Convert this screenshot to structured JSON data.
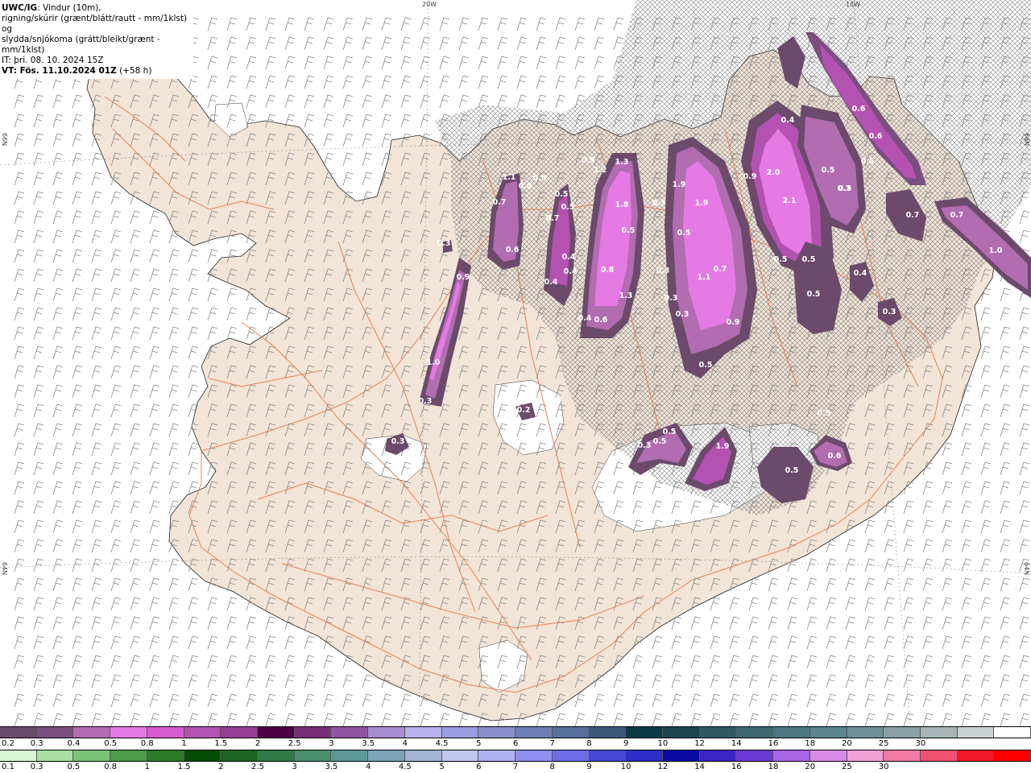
{
  "header": {
    "source": "UWC/IG",
    "description_line1": ": Vindur (10m),",
    "description_line2": "rigning/skúrir (grænt/blátt/rautt - mm/1klst) og",
    "description_line3": "slydda/snjókoma (grátt/bleikt/grænt - mm/1klst)",
    "issued": "IT: þri. 08. 10. 2024 15Z",
    "valid": "VT: Fös. 11.10.2024 01Z",
    "lead": " (+58 h)"
  },
  "grid_labels": {
    "lon_20w": "20W",
    "lon_15w": "15W",
    "lat_66n_left": "66N",
    "lat_66n_right": "66N",
    "lat_64n_left": "64N",
    "lat_64n_right": "64N"
  },
  "precip_values": [
    "0.9",
    "1.2",
    "1.3",
    "1.9",
    "2.0",
    "2.1",
    "0.9",
    "0.8",
    "1.1",
    "0.7",
    "0.5",
    "0.5",
    "0.6",
    "1.8",
    "0.3",
    "1.9",
    "0.5",
    "0.4",
    "0.5",
    "0.7",
    "0.8",
    "0.4",
    "0.4",
    "0.7",
    "0.9",
    "1.0",
    "0.3",
    "0.5",
    "0.7",
    "1.1",
    "0.3",
    "0.6",
    "0.4",
    "0.4",
    "0.6",
    "1.3",
    "0.3",
    "0.3",
    "0.9",
    "0.5",
    "0.5",
    "0.5",
    "0.4",
    "0.3",
    "0.3",
    "0.5",
    "0.6",
    "0.5",
    "0.6",
    "0.5",
    "0.7",
    "0.7",
    "1.0",
    "0.2",
    "0.3",
    "0.3",
    "0.5",
    "0.5",
    "1.9",
    "0.5",
    "0.6",
    "0.5",
    "0.3"
  ],
  "legend_snow": {
    "colors": [
      "#6b4a6b",
      "#7a4e7e",
      "#b26cb0",
      "#e57ae5",
      "#d65bd0",
      "#b452b2",
      "#9a3d96",
      "#4d0046",
      "#7c2e7a",
      "#8e56a1",
      "#a98dd1",
      "#b8b2ec",
      "#9c9ce2",
      "#8990cc",
      "#6f7fb5",
      "#566e9b",
      "#3d5a7a",
      "#0d3b45",
      "#1b4651",
      "#2d5a63",
      "#3c6870",
      "#4c7680",
      "#5c848c",
      "#718f97",
      "#8ba0a5",
      "#a6b4b6",
      "#c9d2d1",
      "#ffffff"
    ],
    "labels": [
      "0.2",
      "0.3",
      "0.4",
      "0.5",
      "0.8",
      "1",
      "1.5",
      "2",
      "2.5",
      "3",
      "3.5",
      "4",
      "4.5",
      "5",
      "6",
      "7",
      "8",
      "9",
      "10",
      "12",
      "14",
      "16",
      "18",
      "20",
      "25",
      "30"
    ]
  },
  "legend_rain": {
    "colors": [
      "#d8f5d5",
      "#a8e0a4",
      "#7cc378",
      "#4c9b48",
      "#2b7a28",
      "#064d05",
      "#1e6620",
      "#2f7a46",
      "#4a8e6d",
      "#5e9896",
      "#7ea3b8",
      "#a2b5d5",
      "#c1c6ee",
      "#b0b0f4",
      "#8f8ff0",
      "#6d6de8",
      "#4747d8",
      "#2e2eca",
      "#0a0aa3",
      "#3a24c2",
      "#6a3ad4",
      "#a865e6",
      "#d78ae6",
      "#f1a1d8",
      "#f27ba3",
      "#f05070",
      "#f01a2a",
      "#ff0000"
    ],
    "labels": [
      "0.1",
      "0.3",
      "0.5",
      "0.8",
      "1",
      "1.5",
      "2",
      "2.5",
      "3",
      "3.5",
      "4",
      "4.5",
      "5",
      "6",
      "7",
      "8",
      "9",
      "10",
      "12",
      "14",
      "16",
      "18",
      "20",
      "25",
      "30"
    ]
  }
}
